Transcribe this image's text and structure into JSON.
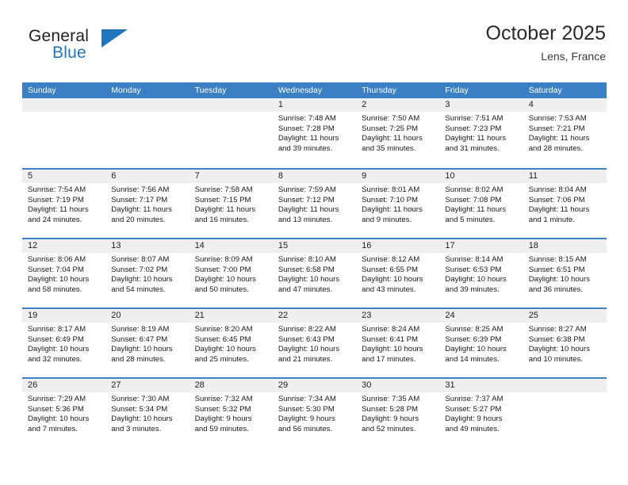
{
  "brand": {
    "name_top": "General",
    "name_bottom": "Blue",
    "accent_color": "#1f76bc"
  },
  "header": {
    "title": "October 2025",
    "subtitle": "Lens, France"
  },
  "calendar": {
    "header_color": "#3b7fc4",
    "day_band_color": "#efefef",
    "weekday_headers": [
      "Sunday",
      "Monday",
      "Tuesday",
      "Wednesday",
      "Thursday",
      "Friday",
      "Saturday"
    ],
    "weeks": [
      [
        {
          "day": "",
          "sunrise": "",
          "sunset": "",
          "daylight_line1": "",
          "daylight_line2": "",
          "empty": true
        },
        {
          "day": "",
          "sunrise": "",
          "sunset": "",
          "daylight_line1": "",
          "daylight_line2": "",
          "empty": true
        },
        {
          "day": "",
          "sunrise": "",
          "sunset": "",
          "daylight_line1": "",
          "daylight_line2": "",
          "empty": true
        },
        {
          "day": "1",
          "sunrise": "Sunrise: 7:48 AM",
          "sunset": "Sunset: 7:28 PM",
          "daylight_line1": "Daylight: 11 hours",
          "daylight_line2": "and 39 minutes.",
          "empty": false
        },
        {
          "day": "2",
          "sunrise": "Sunrise: 7:50 AM",
          "sunset": "Sunset: 7:25 PM",
          "daylight_line1": "Daylight: 11 hours",
          "daylight_line2": "and 35 minutes.",
          "empty": false
        },
        {
          "day": "3",
          "sunrise": "Sunrise: 7:51 AM",
          "sunset": "Sunset: 7:23 PM",
          "daylight_line1": "Daylight: 11 hours",
          "daylight_line2": "and 31 minutes.",
          "empty": false
        },
        {
          "day": "4",
          "sunrise": "Sunrise: 7:53 AM",
          "sunset": "Sunset: 7:21 PM",
          "daylight_line1": "Daylight: 11 hours",
          "daylight_line2": "and 28 minutes.",
          "empty": false
        }
      ],
      [
        {
          "day": "5",
          "sunrise": "Sunrise: 7:54 AM",
          "sunset": "Sunset: 7:19 PM",
          "daylight_line1": "Daylight: 11 hours",
          "daylight_line2": "and 24 minutes.",
          "empty": false
        },
        {
          "day": "6",
          "sunrise": "Sunrise: 7:56 AM",
          "sunset": "Sunset: 7:17 PM",
          "daylight_line1": "Daylight: 11 hours",
          "daylight_line2": "and 20 minutes.",
          "empty": false
        },
        {
          "day": "7",
          "sunrise": "Sunrise: 7:58 AM",
          "sunset": "Sunset: 7:15 PM",
          "daylight_line1": "Daylight: 11 hours",
          "daylight_line2": "and 16 minutes.",
          "empty": false
        },
        {
          "day": "8",
          "sunrise": "Sunrise: 7:59 AM",
          "sunset": "Sunset: 7:12 PM",
          "daylight_line1": "Daylight: 11 hours",
          "daylight_line2": "and 13 minutes.",
          "empty": false
        },
        {
          "day": "9",
          "sunrise": "Sunrise: 8:01 AM",
          "sunset": "Sunset: 7:10 PM",
          "daylight_line1": "Daylight: 11 hours",
          "daylight_line2": "and 9 minutes.",
          "empty": false
        },
        {
          "day": "10",
          "sunrise": "Sunrise: 8:02 AM",
          "sunset": "Sunset: 7:08 PM",
          "daylight_line1": "Daylight: 11 hours",
          "daylight_line2": "and 5 minutes.",
          "empty": false
        },
        {
          "day": "11",
          "sunrise": "Sunrise: 8:04 AM",
          "sunset": "Sunset: 7:06 PM",
          "daylight_line1": "Daylight: 11 hours",
          "daylight_line2": "and 1 minute.",
          "empty": false
        }
      ],
      [
        {
          "day": "12",
          "sunrise": "Sunrise: 8:06 AM",
          "sunset": "Sunset: 7:04 PM",
          "daylight_line1": "Daylight: 10 hours",
          "daylight_line2": "and 58 minutes.",
          "empty": false
        },
        {
          "day": "13",
          "sunrise": "Sunrise: 8:07 AM",
          "sunset": "Sunset: 7:02 PM",
          "daylight_line1": "Daylight: 10 hours",
          "daylight_line2": "and 54 minutes.",
          "empty": false
        },
        {
          "day": "14",
          "sunrise": "Sunrise: 8:09 AM",
          "sunset": "Sunset: 7:00 PM",
          "daylight_line1": "Daylight: 10 hours",
          "daylight_line2": "and 50 minutes.",
          "empty": false
        },
        {
          "day": "15",
          "sunrise": "Sunrise: 8:10 AM",
          "sunset": "Sunset: 6:58 PM",
          "daylight_line1": "Daylight: 10 hours",
          "daylight_line2": "and 47 minutes.",
          "empty": false
        },
        {
          "day": "16",
          "sunrise": "Sunrise: 8:12 AM",
          "sunset": "Sunset: 6:55 PM",
          "daylight_line1": "Daylight: 10 hours",
          "daylight_line2": "and 43 minutes.",
          "empty": false
        },
        {
          "day": "17",
          "sunrise": "Sunrise: 8:14 AM",
          "sunset": "Sunset: 6:53 PM",
          "daylight_line1": "Daylight: 10 hours",
          "daylight_line2": "and 39 minutes.",
          "empty": false
        },
        {
          "day": "18",
          "sunrise": "Sunrise: 8:15 AM",
          "sunset": "Sunset: 6:51 PM",
          "daylight_line1": "Daylight: 10 hours",
          "daylight_line2": "and 36 minutes.",
          "empty": false
        }
      ],
      [
        {
          "day": "19",
          "sunrise": "Sunrise: 8:17 AM",
          "sunset": "Sunset: 6:49 PM",
          "daylight_line1": "Daylight: 10 hours",
          "daylight_line2": "and 32 minutes.",
          "empty": false
        },
        {
          "day": "20",
          "sunrise": "Sunrise: 8:19 AM",
          "sunset": "Sunset: 6:47 PM",
          "daylight_line1": "Daylight: 10 hours",
          "daylight_line2": "and 28 minutes.",
          "empty": false
        },
        {
          "day": "21",
          "sunrise": "Sunrise: 8:20 AM",
          "sunset": "Sunset: 6:45 PM",
          "daylight_line1": "Daylight: 10 hours",
          "daylight_line2": "and 25 minutes.",
          "empty": false
        },
        {
          "day": "22",
          "sunrise": "Sunrise: 8:22 AM",
          "sunset": "Sunset: 6:43 PM",
          "daylight_line1": "Daylight: 10 hours",
          "daylight_line2": "and 21 minutes.",
          "empty": false
        },
        {
          "day": "23",
          "sunrise": "Sunrise: 8:24 AM",
          "sunset": "Sunset: 6:41 PM",
          "daylight_line1": "Daylight: 10 hours",
          "daylight_line2": "and 17 minutes.",
          "empty": false
        },
        {
          "day": "24",
          "sunrise": "Sunrise: 8:25 AM",
          "sunset": "Sunset: 6:39 PM",
          "daylight_line1": "Daylight: 10 hours",
          "daylight_line2": "and 14 minutes.",
          "empty": false
        },
        {
          "day": "25",
          "sunrise": "Sunrise: 8:27 AM",
          "sunset": "Sunset: 6:38 PM",
          "daylight_line1": "Daylight: 10 hours",
          "daylight_line2": "and 10 minutes.",
          "empty": false
        }
      ],
      [
        {
          "day": "26",
          "sunrise": "Sunrise: 7:29 AM",
          "sunset": "Sunset: 5:36 PM",
          "daylight_line1": "Daylight: 10 hours",
          "daylight_line2": "and 7 minutes.",
          "empty": false
        },
        {
          "day": "27",
          "sunrise": "Sunrise: 7:30 AM",
          "sunset": "Sunset: 5:34 PM",
          "daylight_line1": "Daylight: 10 hours",
          "daylight_line2": "and 3 minutes.",
          "empty": false
        },
        {
          "day": "28",
          "sunrise": "Sunrise: 7:32 AM",
          "sunset": "Sunset: 5:32 PM",
          "daylight_line1": "Daylight: 9 hours",
          "daylight_line2": "and 59 minutes.",
          "empty": false
        },
        {
          "day": "29",
          "sunrise": "Sunrise: 7:34 AM",
          "sunset": "Sunset: 5:30 PM",
          "daylight_line1": "Daylight: 9 hours",
          "daylight_line2": "and 56 minutes.",
          "empty": false
        },
        {
          "day": "30",
          "sunrise": "Sunrise: 7:35 AM",
          "sunset": "Sunset: 5:28 PM",
          "daylight_line1": "Daylight: 9 hours",
          "daylight_line2": "and 52 minutes.",
          "empty": false
        },
        {
          "day": "31",
          "sunrise": "Sunrise: 7:37 AM",
          "sunset": "Sunset: 5:27 PM",
          "daylight_line1": "Daylight: 9 hours",
          "daylight_line2": "and 49 minutes.",
          "empty": false
        },
        {
          "day": "",
          "sunrise": "",
          "sunset": "",
          "daylight_line1": "",
          "daylight_line2": "",
          "empty": true
        }
      ]
    ]
  }
}
